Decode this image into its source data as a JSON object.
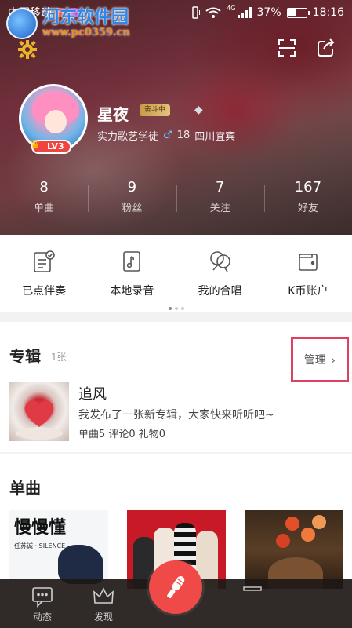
{
  "status_bar": {
    "carrier": "中国移动",
    "network": "4G",
    "battery": "37%",
    "battery_level": 0.37,
    "time": "18:16"
  },
  "watermark": {
    "title": "河东软件园",
    "url": "www.pc0359.cn"
  },
  "profile": {
    "name": "星夜",
    "title_badge": "奋斗中",
    "level": "LV3",
    "subtitle": "实力歌艺学徒",
    "age": "18",
    "location": "四川宜宾"
  },
  "stats": [
    {
      "value": "8",
      "label": "单曲"
    },
    {
      "value": "9",
      "label": "粉丝"
    },
    {
      "value": "7",
      "label": "关注"
    },
    {
      "value": "167",
      "label": "好友"
    }
  ],
  "actions": [
    {
      "label": "已点伴奏",
      "icon": "checklist-icon"
    },
    {
      "label": "本地录音",
      "icon": "local-recording-icon"
    },
    {
      "label": "我的合唱",
      "icon": "chorus-icon"
    },
    {
      "label": "K币账户",
      "icon": "wallet-icon"
    }
  ],
  "album_section": {
    "title": "专辑",
    "count": "1张",
    "manage_label": "管理",
    "album": {
      "name": "追风",
      "description": "我发布了一张新专辑，大家快来听听吧~",
      "meta": "单曲5 评论0 礼物0"
    }
  },
  "single_section": {
    "title": "单曲",
    "cover1_title": "慢慢懂",
    "cover1_subtitle": "任苏诚 · SILENCE"
  },
  "bottom_nav": {
    "items": [
      {
        "label": "动态",
        "icon": "feed-icon"
      },
      {
        "label": "发现",
        "icon": "crown-icon"
      }
    ]
  }
}
